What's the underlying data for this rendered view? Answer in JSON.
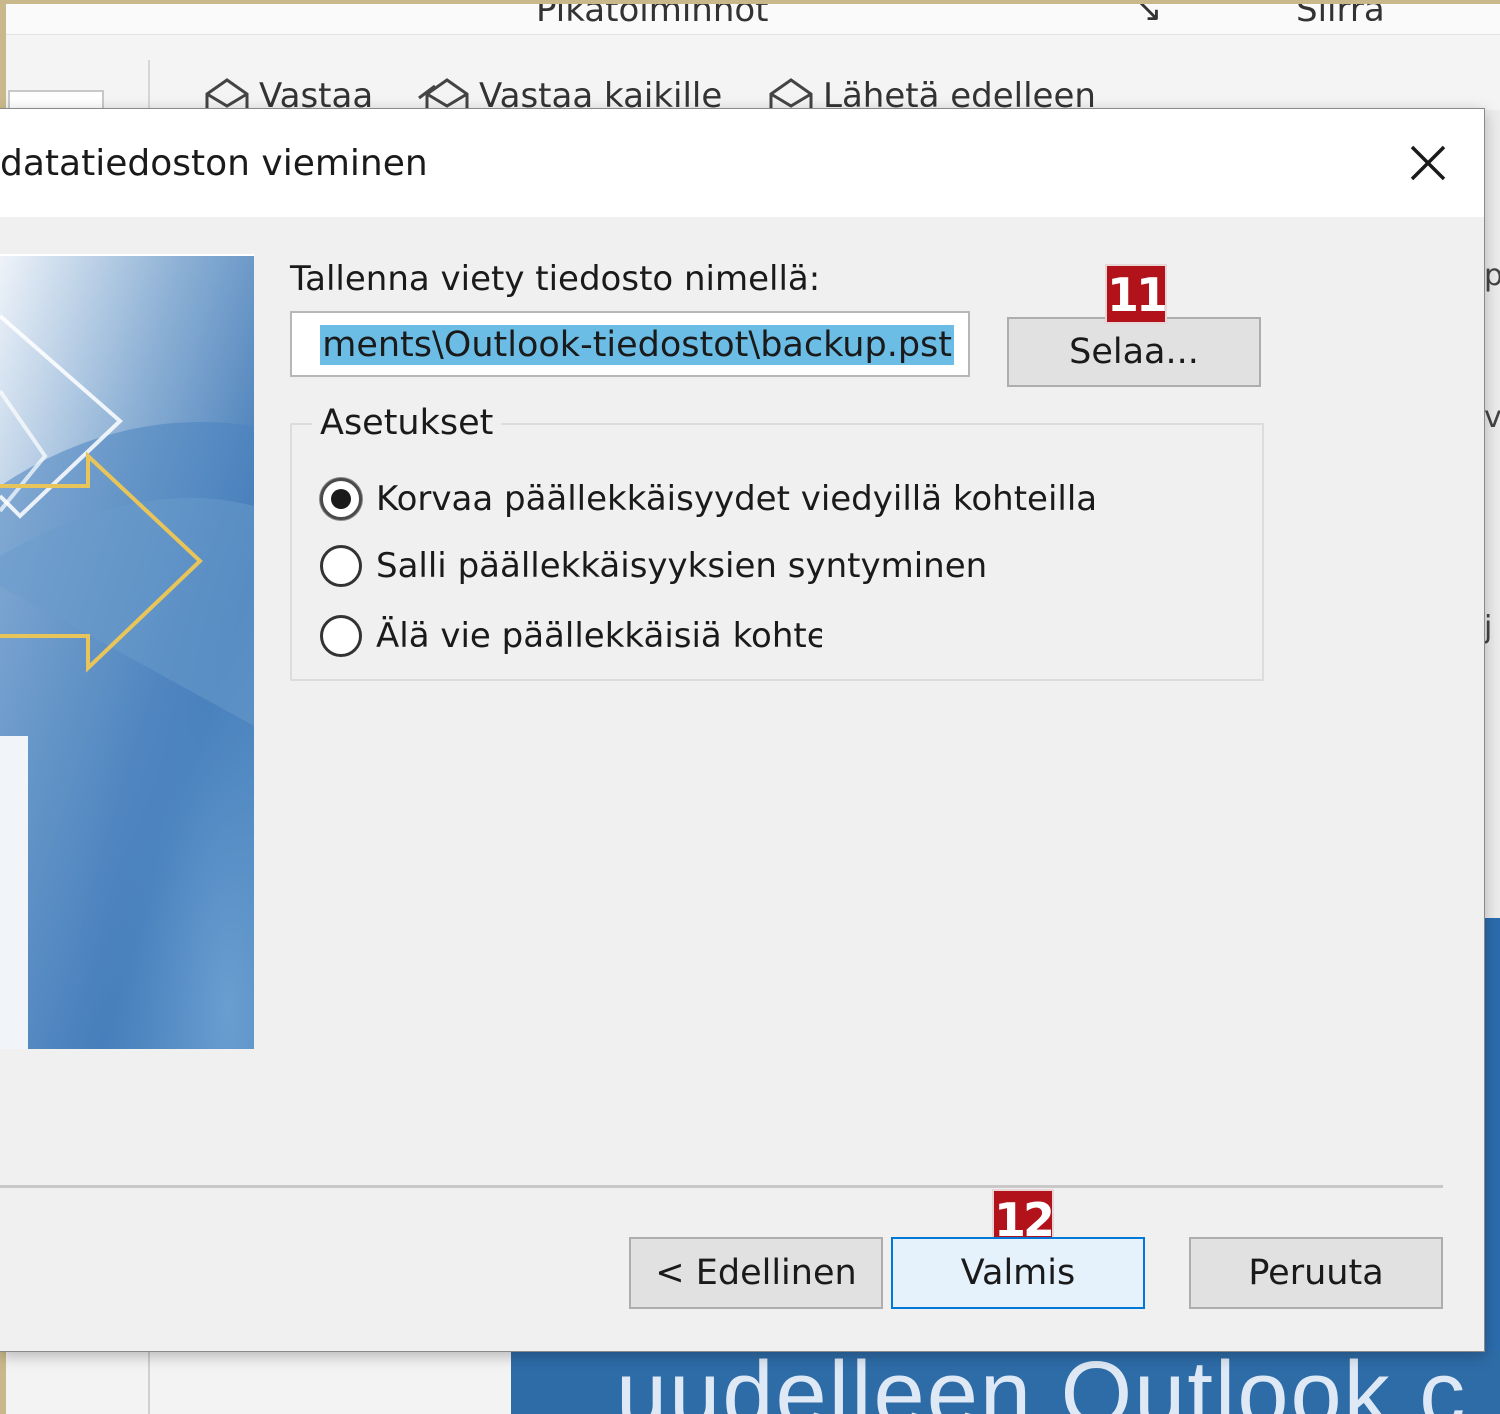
{
  "background": {
    "ribbon_group_1": "Pikatoiminnot",
    "ribbon_group_2": "Siirrä",
    "reply": "Vastaa",
    "reply_all": "Vastaa kaikille",
    "forward": "Lähetä edelleen",
    "banner_text": "uudelleen Outlook c",
    "right_letters": [
      "p",
      "v",
      "j"
    ]
  },
  "dialog": {
    "title": "datatiedoston vieminen",
    "save_label": "Tallenna viety tiedosto nimellä:",
    "path_value": "ments\\Outlook-tiedostot\\backup.pst",
    "browse_label": "Selaa...",
    "options_legend": "Asetukset",
    "options": [
      {
        "label": "Korvaa päällekkäisyydet viedyillä kohteilla",
        "selected": true
      },
      {
        "label": "Salli päällekkäisyyksien syntyminen",
        "selected": false
      },
      {
        "label": "Älä vie päällekkäisiä kohteita",
        "selected": false
      }
    ],
    "back_label": "< Edellinen",
    "finish_label": "Valmis",
    "cancel_label": "Peruuta"
  },
  "annotations": {
    "badge_browse": "11",
    "badge_finish": "12",
    "badge_color": "#b2121a"
  },
  "colors": {
    "selection": "#6cbde6",
    "banner_blue": "#2e6ca8",
    "accent_arrow": "#e8c55a"
  }
}
